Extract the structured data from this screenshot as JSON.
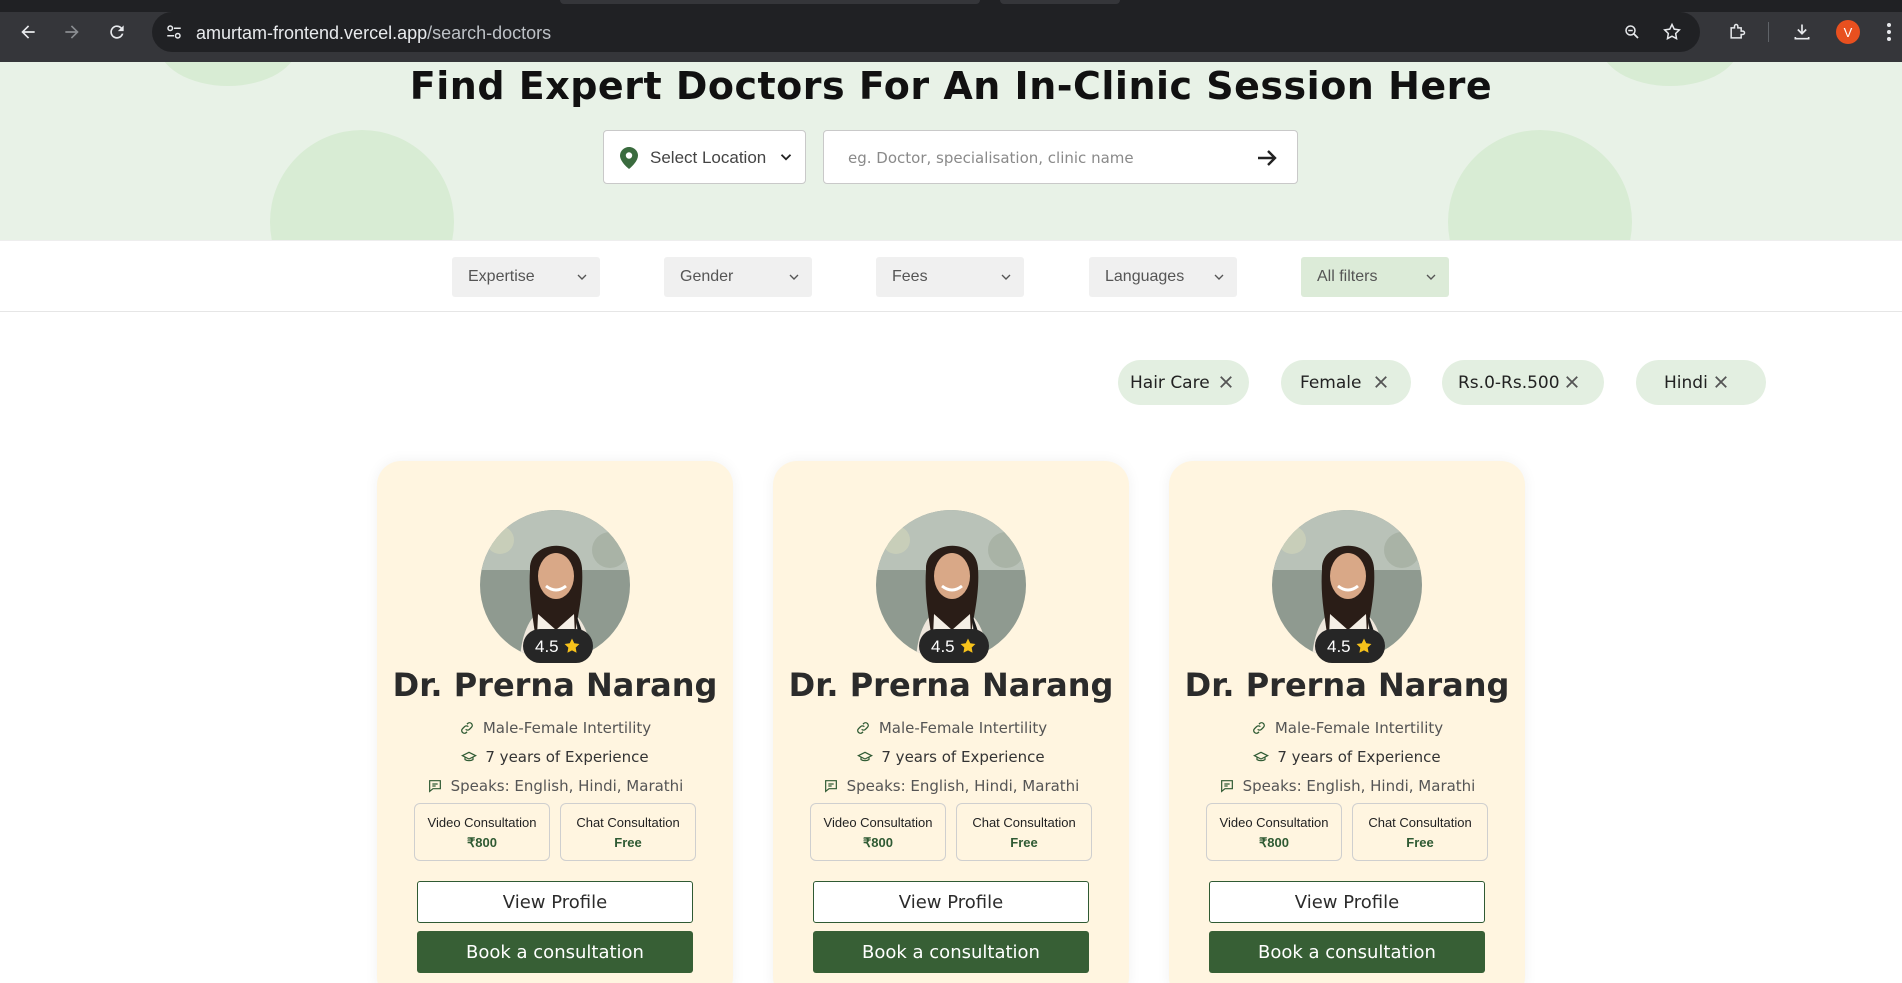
{
  "browser": {
    "url_host": "amurtam-frontend.vercel.app",
    "url_path": "/search-doctors",
    "profile_initial": "V"
  },
  "hero": {
    "title": "Find Expert Doctors For An In-Clinic Session Here",
    "location_label": "Select Location",
    "search_placeholder": "eg. Doctor, specialisation, clinic name",
    "accent_color": "#3a6b3e"
  },
  "filters": {
    "expertise": "Expertise",
    "gender": "Gender",
    "fees": "Fees",
    "languages": "Languages",
    "all_filters": "All filters"
  },
  "chips": [
    "Hair Care",
    "Female",
    "Rs.0-Rs.500",
    "Hindi"
  ],
  "cards": [
    {
      "rating": "4.5",
      "name": "Dr. Prerna Narang",
      "specialty": "Male-Female Intertility",
      "experience": "7 years of Experience",
      "languages": "Speaks: English, Hindi, Marathi",
      "video_label": "Video Consultation",
      "video_price": "₹800",
      "chat_label": "Chat Consultation",
      "chat_price": "Free",
      "view_label": "View Profile",
      "book_label": "Book a consultation"
    },
    {
      "rating": "4.5",
      "name": "Dr. Prerna Narang",
      "specialty": "Male-Female Intertility",
      "experience": "7 years of Experience",
      "languages": "Speaks: English, Hindi, Marathi",
      "video_label": "Video Consultation",
      "video_price": "₹800",
      "chat_label": "Chat Consultation",
      "chat_price": "Free",
      "view_label": "View Profile",
      "book_label": "Book a consultation"
    },
    {
      "rating": "4.5",
      "name": "Dr. Prerna Narang",
      "specialty": "Male-Female Intertility",
      "experience": "7 years of Experience",
      "languages": "Speaks: English, Hindi, Marathi",
      "video_label": "Video Consultation",
      "video_price": "₹800",
      "chat_label": "Chat Consultation",
      "chat_price": "Free",
      "view_label": "View Profile",
      "book_label": "Book a consultation"
    }
  ],
  "colors": {
    "brand_green": "#375f35",
    "card_bg": "#fff5e0",
    "hero_bg": "#e8f2e7"
  }
}
